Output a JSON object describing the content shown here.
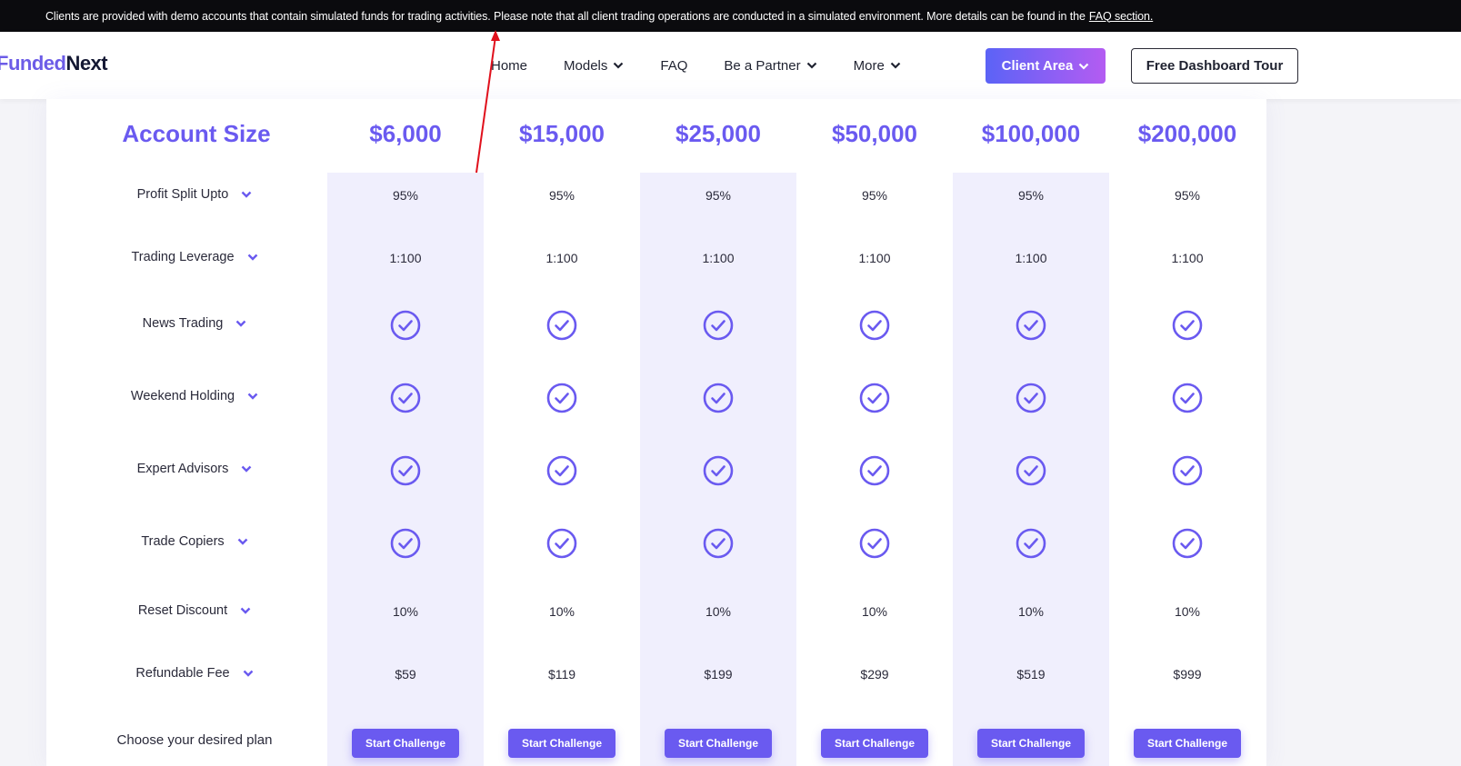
{
  "notice": {
    "text": "Clients are provided with demo accounts that contain simulated funds for trading activities. Please note that all client trading operations are conducted in a simulated environment. More details can be found in the",
    "link": "FAQ section."
  },
  "brand": {
    "part1": "Funded",
    "part2": "Next"
  },
  "nav": {
    "items": [
      {
        "label": "Home"
      },
      {
        "label": "Models"
      },
      {
        "label": "FAQ"
      },
      {
        "label": "Be a Partner"
      },
      {
        "label": "More"
      }
    ],
    "client_area": "Client Area",
    "dashboard_tour": "Free Dashboard Tour"
  },
  "table": {
    "header_label": "Account Size",
    "sizes": [
      "$6,000",
      "$15,000",
      "$25,000",
      "$50,000",
      "$100,000",
      "$200,000"
    ],
    "rows": [
      {
        "label": "Profit Split Upto",
        "values": [
          "95%",
          "95%",
          "95%",
          "95%",
          "95%",
          "95%"
        ]
      },
      {
        "label": "Trading Leverage",
        "values": [
          "1:100",
          "1:100",
          "1:100",
          "1:100",
          "1:100",
          "1:100"
        ]
      },
      {
        "label": "News Trading",
        "check": true
      },
      {
        "label": "Weekend Holding",
        "check": true
      },
      {
        "label": "Expert Advisors",
        "check": true
      },
      {
        "label": "Trade Copiers",
        "check": true
      },
      {
        "label": "Reset Discount",
        "values": [
          "10%",
          "10%",
          "10%",
          "10%",
          "10%",
          "10%"
        ]
      },
      {
        "label": "Refundable Fee",
        "values": [
          "$59",
          "$119",
          "$199",
          "$299",
          "$519",
          "$999"
        ]
      }
    ],
    "choose_label": "Choose your desired plan",
    "start_label": "Start Challenge"
  },
  "colors": {
    "accent": "#6a5af0",
    "highlight_col": "#f0effd",
    "annotation": "#e0101c"
  },
  "icons": [
    "chevron-down-icon",
    "check-circle-icon"
  ]
}
